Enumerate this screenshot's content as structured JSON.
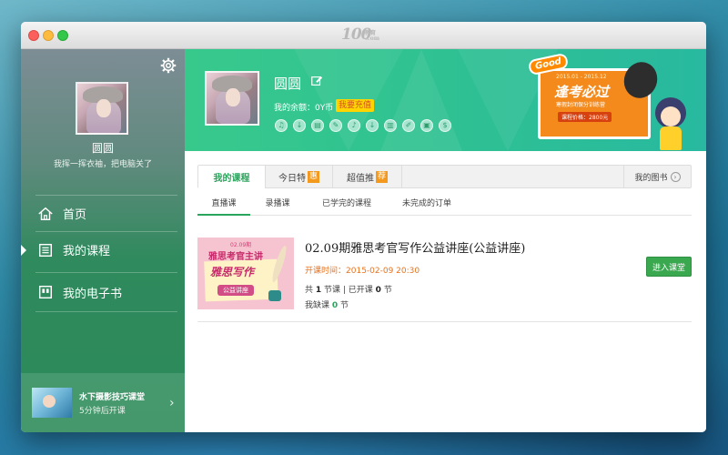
{
  "app": {
    "logo_text": "100",
    "logo_sub_a": "教育",
    "logo_sub_b": ".com"
  },
  "sidebar": {
    "username": "圆圆",
    "motto": "我挥一挥衣袖，把电脑关了",
    "nav": [
      {
        "label": "首页",
        "icon": "home-icon"
      },
      {
        "label": "我的课程",
        "icon": "course-list-icon"
      },
      {
        "label": "我的电子书",
        "icon": "ebook-icon"
      }
    ],
    "promo": {
      "title": "水下摄影技巧课堂",
      "subtitle": "5分钟后开课"
    }
  },
  "profile": {
    "name": "圆圆",
    "balance_label": "我的余额：0Y币",
    "recharge_label": "我要充值"
  },
  "ad": {
    "good": "Good",
    "date": "2015.01 - 2015.12",
    "headline": "逢考必过",
    "line2": "寒假封闭保分训练营",
    "price": "课程价格：2800元"
  },
  "tabs": {
    "items": [
      {
        "label": "我的课程",
        "tag": ""
      },
      {
        "label": "今日特",
        "tag": "惠"
      },
      {
        "label": "超值推",
        "tag": "荐"
      }
    ],
    "books_label": "我的图书"
  },
  "subtabs": [
    "直播课",
    "录播课",
    "已学完的课程",
    "未完成的订单"
  ],
  "course": {
    "thumb_top": "02.09期",
    "thumb_a": "雅思考官主讲",
    "thumb_b": "雅思写作",
    "thumb_c": "公益讲座",
    "title": "02.09期雅思考官写作公益讲座(公益讲座)",
    "time_label": "开课时间：",
    "time_value": "2015-02-09 20:30",
    "count_prefix": "共",
    "total": "1",
    "count_mid": "节课 | 已开课",
    "started": "0",
    "count_suffix": "节",
    "miss_prefix": "我缺课",
    "missed": "0",
    "miss_suffix": "节",
    "enter_label": "进入课堂"
  },
  "colors": {
    "accent_green": "#2aa55c",
    "banner_green": "#37c98c",
    "orange": "#e8731e"
  }
}
